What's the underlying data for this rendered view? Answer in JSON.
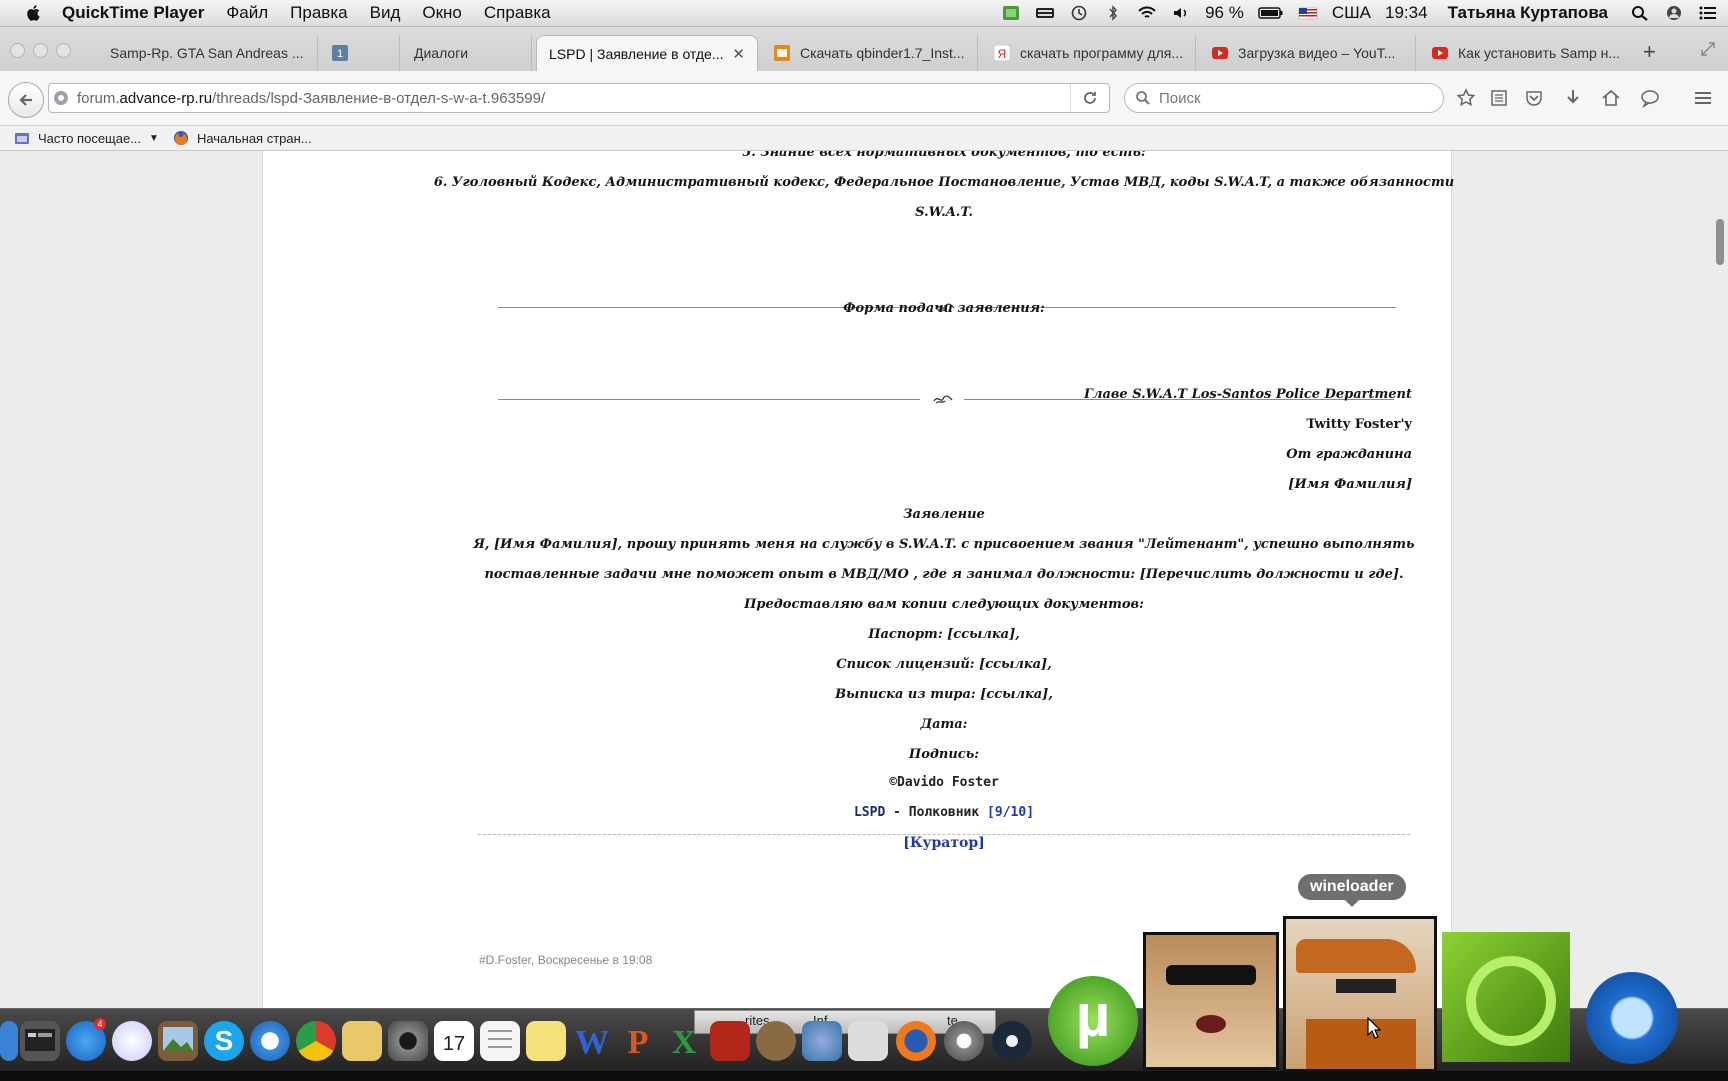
{
  "menubar": {
    "app_name": "QuickTime Player",
    "menus": [
      "Файл",
      "Правка",
      "Вид",
      "Окно",
      "Справка"
    ],
    "battery": "96 %",
    "input_source": "США",
    "clock": "19:34",
    "user": "Татьяна Куртапова"
  },
  "tabs": [
    {
      "title": "Samp-Rp. GTA San Andreas ...",
      "icon": "samp-favicon"
    },
    {
      "title": "",
      "icon": "vk-favicon",
      "badge": "1"
    },
    {
      "title": "Диалоги",
      "icon": "none"
    },
    {
      "title": "LSPD | Заявление в отде...",
      "icon": "none",
      "active": true
    },
    {
      "title": "Скачать qbinder1.7_Inst...",
      "icon": "softportal-favicon"
    },
    {
      "title": "скачать программу для...",
      "icon": "yandex-favicon"
    },
    {
      "title": "Загрузка видео – YouT...",
      "icon": "youtube-favicon"
    },
    {
      "title": "Как установить Samp н...",
      "icon": "youtube-favicon"
    }
  ],
  "address": {
    "scheme_host_prefix": "forum.",
    "host_main": "advance-rp.ru",
    "path": "/threads/lspd-Заявление-в-отдел-s-w-a-t.963599/"
  },
  "search": {
    "placeholder": "Поиск"
  },
  "bookmarks": [
    "Часто посещае...",
    "Начальная стран..."
  ],
  "post": {
    "line_top_cut": "5. Знание всех нормативных документов, то есть:",
    "line6a": "6. Уголовный Кодекс, Административный кодекс, Федеральное Постановление, Устав МВД, коды S.W.A.T, а также обязанности",
    "line6b": "S.W.A.T.",
    "form_title": "Форма подачи заявления:",
    "addr1": "Главе S.W.A.T Los-Santos Police Department",
    "addr2": "Twitty Foster'y",
    "addr3": "От гражданина",
    "addr4": "[Имя Фамилия]",
    "statement": "Заявление",
    "body1": "Я, [Имя Фамилия], прошу принять меня на службу в S.W.A.T. с присвоением звания \"Лейтенант\", успешно выполнять",
    "body2": "поставленные задачи мне поможет опыт в МВД/МО , где я занимал должности: [Перечислить должности и где].",
    "docs": "Предоставляю вам копии следующих документов:",
    "passport": "Паспорт: [ссылка],",
    "licenses": "Список лицензий: [ссылка],",
    "tir": "Выписка из тира: [ссылка],",
    "date": "Дата:",
    "signature": "Подпись:",
    "sig_copyright": "©Davido Foster",
    "sig_org": "LSPD",
    "sig_dash": " - ",
    "sig_rank": "Полковник",
    "sig_rank_num": "[9/10]",
    "sig_role": "[Куратор]",
    "meta": "#D.Foster, Воскресенье в 19:08"
  },
  "dock": {
    "stack_labels": [
      "rites",
      "Inf",
      "te"
    ],
    "tooltip": "wineloader",
    "calendar_day": "17",
    "appstore_badge": "4"
  },
  "colors": {
    "link_blue": "#1f3aa0",
    "sig_navy": "#1b2a6b",
    "menubar_bg": "#e8e8e8",
    "page_bg": "#ffffff"
  }
}
